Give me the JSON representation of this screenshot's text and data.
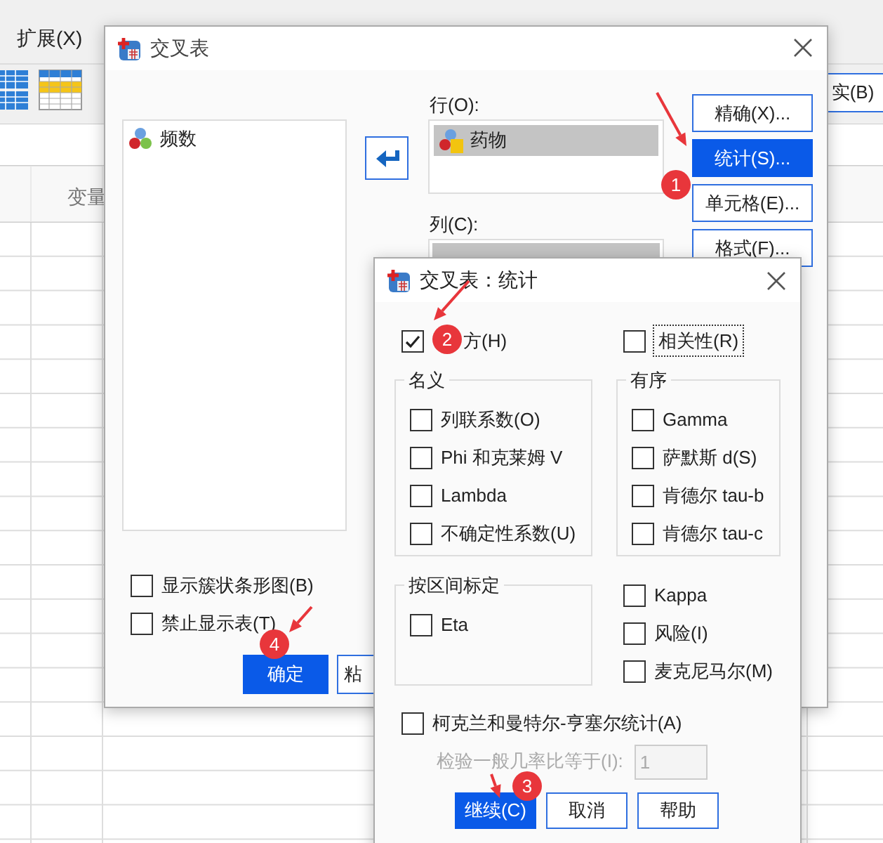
{
  "app": {
    "menu": [
      "扩展(X)"
    ],
    "toolbar_button": "实(B)",
    "columns": [
      "变量"
    ]
  },
  "crosstabs": {
    "title": "交叉表",
    "variables": [
      {
        "label": "频数",
        "selected": false
      }
    ],
    "row_label": "行(O):",
    "rows": [
      {
        "label": "药物",
        "selected": true
      }
    ],
    "column_label": "列(C):",
    "side_buttons": [
      {
        "label": "精确(X)...",
        "selected": false
      },
      {
        "label": "统计(S)...",
        "selected": true
      },
      {
        "label": "单元格(E)...",
        "selected": false
      },
      {
        "label": "格式(F)...",
        "selected": false
      }
    ],
    "options": [
      {
        "label": "显示簇状条形图(B)",
        "checked": false
      },
      {
        "label": "禁止显示表(T)",
        "checked": false
      }
    ],
    "buttons": [
      {
        "label": "确定",
        "primary": true
      },
      {
        "label": "粘",
        "primary": false
      }
    ]
  },
  "statistics": {
    "title": "交叉表：统计",
    "top": [
      {
        "label": "方(H)",
        "checked": true,
        "focused": false
      },
      {
        "label": "相关性(R)",
        "checked": false,
        "focused": true
      }
    ],
    "groups": [
      {
        "title": "名义",
        "items": [
          {
            "label": "列联系数(O)",
            "checked": false
          },
          {
            "label": "Phi 和克莱姆 V",
            "checked": false
          },
          {
            "label": "Lambda",
            "checked": false
          },
          {
            "label": "不确定性系数(U)",
            "checked": false
          }
        ]
      },
      {
        "title": "有序",
        "items": [
          {
            "label": "Gamma",
            "checked": false
          },
          {
            "label": "萨默斯 d(S)",
            "checked": false
          },
          {
            "label": "肯德尔 tau-b",
            "checked": false
          },
          {
            "label": "肯德尔 tau-c",
            "checked": false
          }
        ]
      },
      {
        "title": "按区间标定",
        "items": [
          {
            "label": "Eta",
            "checked": false
          }
        ]
      }
    ],
    "other": [
      {
        "label": "Kappa",
        "checked": false
      },
      {
        "label": "风险(I)",
        "checked": false
      },
      {
        "label": "麦克尼马尔(M)",
        "checked": false
      }
    ],
    "cmh": {
      "label": "柯克兰和曼特尔-亨塞尔统计(A)",
      "checked": false
    },
    "odds_ratio": {
      "label": "检验一般几率比等于(I):",
      "value": "1",
      "disabled": true
    },
    "buttons": [
      {
        "label": "继续(C)",
        "primary": true
      },
      {
        "label": "取消",
        "primary": false
      },
      {
        "label": "帮助",
        "primary": false
      }
    ]
  },
  "annotations": [
    {
      "number": "1"
    },
    {
      "number": "2"
    },
    {
      "number": "3"
    },
    {
      "number": "4"
    }
  ]
}
